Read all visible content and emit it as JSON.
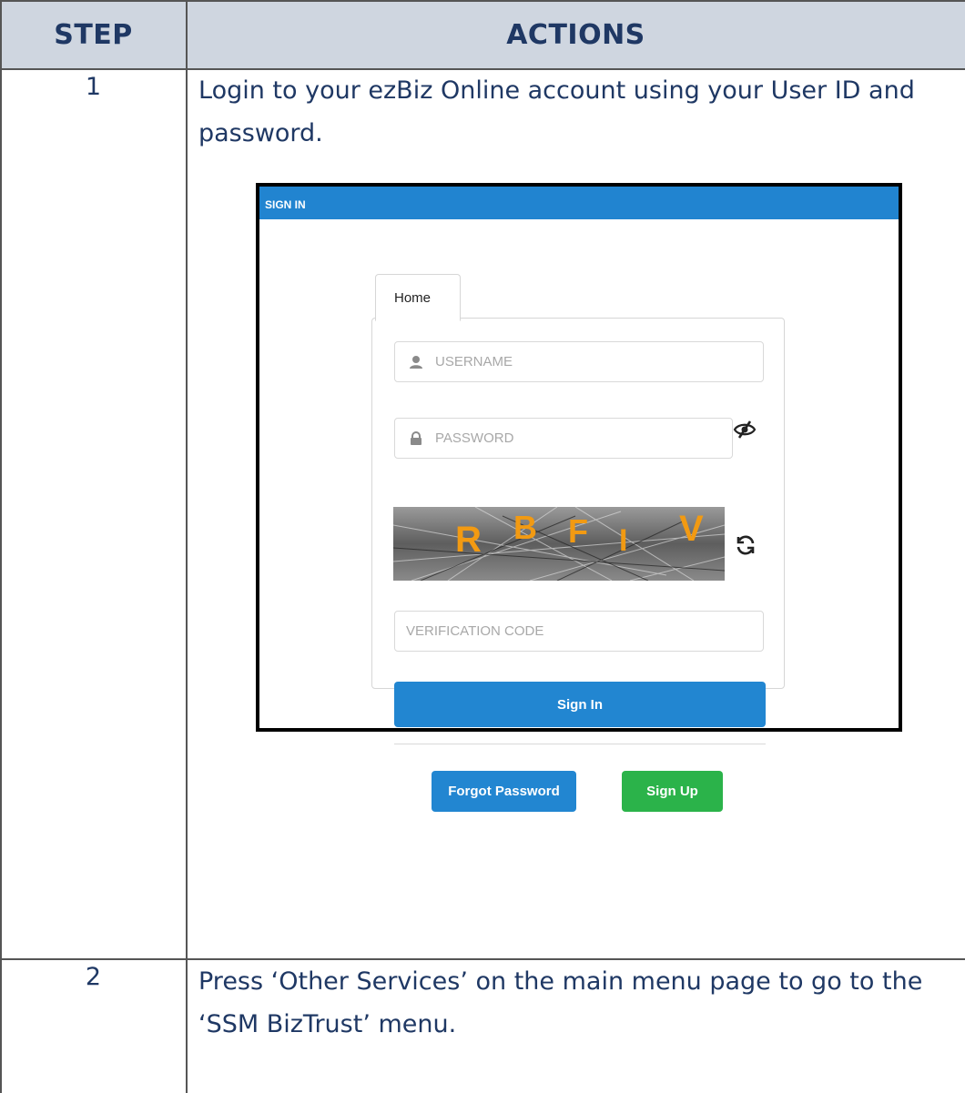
{
  "table": {
    "headers": {
      "step": "STEP",
      "actions": "ACTIONS"
    },
    "rows": [
      {
        "step": "1",
        "text": "Login to your ezBiz Online account using your User ID and password."
      },
      {
        "step": "2",
        "text": "Press ‘Other Services’ on the main menu page to go to the ‘SSM BizTrust’ menu."
      }
    ]
  },
  "login_screenshot": {
    "header": "SIGN IN",
    "tab": "Home",
    "username_placeholder": "USERNAME",
    "password_placeholder": "PASSWORD",
    "captcha_letters": [
      "R",
      "B",
      "F",
      "I",
      "V"
    ],
    "verification_placeholder": "VERIFICATION CODE",
    "sign_in_label": "Sign In",
    "forgot_password_label": "Forgot Password",
    "sign_up_label": "Sign Up",
    "colors": {
      "primary": "#2286d1",
      "success": "#2bb34a",
      "captcha_text": "#f29a12"
    }
  }
}
